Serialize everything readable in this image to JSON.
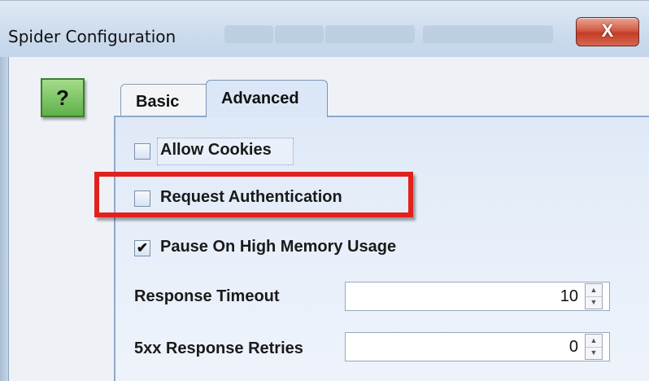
{
  "window": {
    "title": "Spider Configuration",
    "close_glyph": "X"
  },
  "help": {
    "glyph": "?"
  },
  "tabs": [
    {
      "label": "Basic",
      "selected": false
    },
    {
      "label": "Advanced",
      "selected": true
    }
  ],
  "options": {
    "allow_cookies": {
      "label": "Allow Cookies",
      "checked": false
    },
    "request_auth": {
      "label": "Request Authentication",
      "checked": false
    },
    "pause_memory": {
      "label": "Pause On High Memory Usage",
      "checked": true,
      "check_glyph": "✔"
    }
  },
  "fields": {
    "response_timeout": {
      "label": "Response Timeout",
      "value": "10"
    },
    "retries": {
      "label": "5xx Response Retries",
      "value": "0"
    }
  },
  "spinner_glyphs": {
    "up": "▲",
    "down": "▼"
  },
  "colors": {
    "highlight": "#e2201c",
    "help_icon": "#5fb04a",
    "close_button": "#c33d26"
  }
}
